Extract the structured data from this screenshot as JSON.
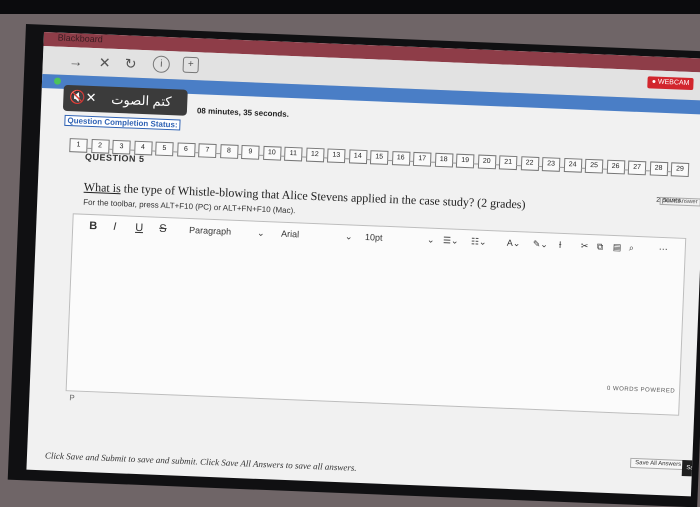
{
  "window": {
    "title": "Blackboard"
  },
  "browser": {
    "back": "→",
    "close": "✕",
    "reload": "↻",
    "info": "ⓘ",
    "bookmark": "⊕"
  },
  "recording": {
    "badge": "● WEBCAM"
  },
  "popup": {
    "mute_icon": "🔇✕",
    "label": "كتم الصوت"
  },
  "assessment": {
    "timer": "08 minutes, 35 seconds.",
    "completion_status": "Question Completion Status:",
    "question_numbers": [
      "1",
      "2",
      "3",
      "4",
      "5",
      "6",
      "7",
      "8",
      "9",
      "10",
      "11",
      "12",
      "13",
      "14",
      "15",
      "16",
      "17",
      "18",
      "19",
      "20",
      "21",
      "22",
      "23",
      "24",
      "25",
      "26",
      "27",
      "28",
      "29"
    ],
    "section_heading": "QUESTION 5",
    "points": "2 points",
    "save_answer": "Save Answer"
  },
  "question": {
    "prefix": "What is",
    "text": " the type of Whistle-blowing that Alice Stevens applied in the case study? (2 grades)",
    "toolbar_hint": "For the toolbar, press ALT+F10 (PC) or ALT+FN+F10 (Mac)."
  },
  "editor": {
    "bold": "B",
    "italic": "I",
    "underline": "U",
    "strike": "S",
    "paragraph": "Paragraph",
    "font": "Arial",
    "size": "10pt",
    "word_count": "0 WORDS  POWERED",
    "path": "P"
  },
  "footer": {
    "instructions": "Click Save and Submit to save and submit. Click Save All Answers to save all answers.",
    "save_all": "Save All Answers",
    "save_submit": "Sa"
  }
}
